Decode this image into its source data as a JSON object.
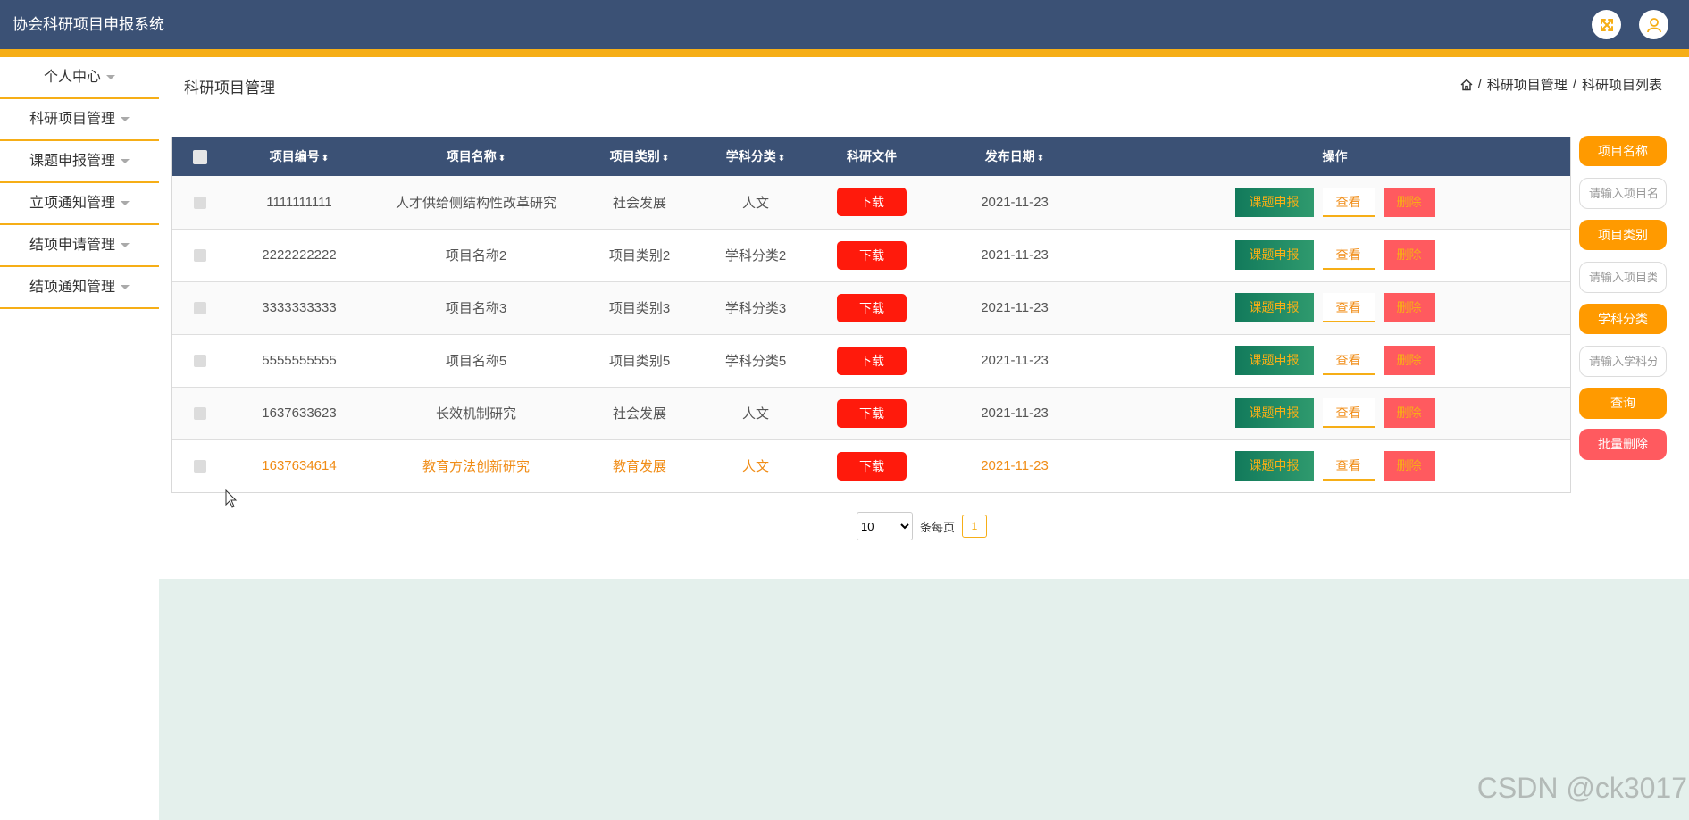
{
  "app": {
    "title": "协会科研项目申报系统"
  },
  "header": {
    "fullscreen_icon": "fullscreen-icon",
    "user_icon": "user-icon"
  },
  "sidebar": {
    "items": [
      {
        "label": "个人中心"
      },
      {
        "label": "科研项目管理"
      },
      {
        "label": "课题申报管理"
      },
      {
        "label": "立项通知管理"
      },
      {
        "label": "结项申请管理"
      },
      {
        "label": "结项通知管理"
      }
    ]
  },
  "page": {
    "title": "科研项目管理",
    "breadcrumb": [
      "科研项目管理",
      "科研项目列表"
    ]
  },
  "table": {
    "columns": [
      "项目编号",
      "项目名称",
      "项目类别",
      "学科分类",
      "科研文件",
      "发布日期",
      "操作"
    ],
    "rows": [
      {
        "id": "1111111111",
        "name": "人才供给侧结构性改革研究",
        "category": "社会发展",
        "subject": "人文",
        "date": "2021-11-23"
      },
      {
        "id": "2222222222",
        "name": "项目名称2",
        "category": "项目类别2",
        "subject": "学科分类2",
        "date": "2021-11-23"
      },
      {
        "id": "3333333333",
        "name": "项目名称3",
        "category": "项目类别3",
        "subject": "学科分类3",
        "date": "2021-11-23"
      },
      {
        "id": "5555555555",
        "name": "项目名称5",
        "category": "项目类别5",
        "subject": "学科分类5",
        "date": "2021-11-23"
      },
      {
        "id": "1637633623",
        "name": "长效机制研究",
        "category": "社会发展",
        "subject": "人文",
        "date": "2021-11-23"
      },
      {
        "id": "1637634614",
        "name": "教育方法创新研究",
        "category": "教育发展",
        "subject": "人文",
        "date": "2021-11-23"
      }
    ],
    "download_label": "下载",
    "actions": {
      "apply": "课题申报",
      "view": "查看",
      "delete": "删除"
    }
  },
  "search": {
    "name_label": "项目名称",
    "name_placeholder": "请输入项目名称",
    "category_label": "项目类别",
    "category_placeholder": "请输入项目类别",
    "subject_label": "学科分类",
    "subject_placeholder": "请输入学科分类",
    "query_label": "查询",
    "batch_delete_label": "批量删除"
  },
  "pagination": {
    "page_size": "10",
    "per_page_label": "条每页",
    "current_page": "1"
  },
  "watermark": "CSDN @ck3017",
  "colors": {
    "header": "#3b5175",
    "accent": "#f6ae17",
    "orange": "#ff9a00",
    "danger": "#ff1a0c"
  }
}
